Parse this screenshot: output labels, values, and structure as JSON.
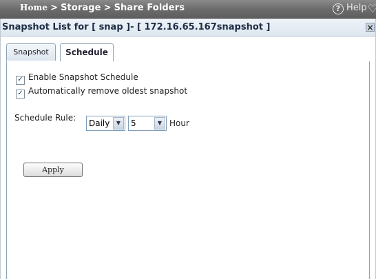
{
  "breadcrumb": {
    "home": "Home",
    "storage": "Storage",
    "share_folders": "Share Folders",
    "separator": ">"
  },
  "help": {
    "label": "Help",
    "glyph": "?"
  },
  "dialog": {
    "title": "Snapshot List for [ snap ]- [ 172.16.65.167snapshot ]",
    "close_glyph": "×"
  },
  "tabs": [
    {
      "label": "Snapshot",
      "active": false
    },
    {
      "label": "Schedule",
      "active": true
    }
  ],
  "schedule": {
    "enable_label": "Enable Snapshot Schedule",
    "enable_checked": true,
    "auto_remove_label": "Automatically remove oldest snapshot",
    "auto_remove_checked": true,
    "rule_label": "Schedule Rule:",
    "frequency_value": "Daily",
    "hour_value": "5",
    "hour_unit": "Hour",
    "apply_label": "Apply"
  },
  "icons": {
    "check": "✓",
    "dropdown": "▼",
    "heart": "♡"
  }
}
